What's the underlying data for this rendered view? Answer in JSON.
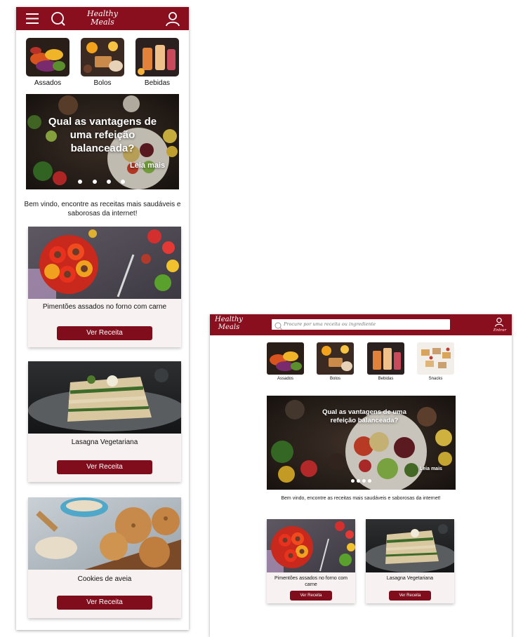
{
  "brand": {
    "line1": "Healthy",
    "line2": "Meals"
  },
  "colors": {
    "brand": "#8a0f1e",
    "button": "#7f0d1c",
    "card_bg": "#f7f1f1"
  },
  "mobile": {
    "categories": [
      {
        "label": "Assados",
        "icon": "roasted-vegetables-image"
      },
      {
        "label": "Bolos",
        "icon": "cakes-image"
      },
      {
        "label": "Bebidas",
        "icon": "drinks-image"
      }
    ],
    "hero": {
      "title": "Qual as vantagens de uma refeição balanceada?",
      "link": "Leia mais",
      "dots": 4
    },
    "welcome": "Bem vindo, encontre as receitas mais saudáveis e saborosas da internet!",
    "recipes": [
      {
        "title": "Pimentões assados no forno com carne",
        "button": "Ver Receita"
      },
      {
        "title": "Lasagna Vegetariana",
        "button": "Ver Receita"
      },
      {
        "title": "Cookies de aveia",
        "button": "Ver Receita"
      }
    ]
  },
  "desktop": {
    "search_placeholder": "Procure por uma receita ou ingrediente",
    "login_label": "Entrar",
    "categories": [
      {
        "label": "Assados",
        "icon": "roasted-vegetables-image"
      },
      {
        "label": "Bolos",
        "icon": "cakes-image"
      },
      {
        "label": "Bebidas",
        "icon": "drinks-image"
      },
      {
        "label": "Snacks",
        "icon": "snacks-image"
      }
    ],
    "hero": {
      "title": "Qual as vantagens de uma refeição balanceada?",
      "link": "Leia mais",
      "dots": 4
    },
    "welcome": "Bem vindo, encontre as receitas mais saudáveis e saborosas da internet!",
    "recipes": [
      {
        "title": "Pimentões assados no forno com carne",
        "button": "Ver Receita"
      },
      {
        "title": "Lasagna Vegetariana",
        "button": "Ver Receita"
      }
    ]
  }
}
